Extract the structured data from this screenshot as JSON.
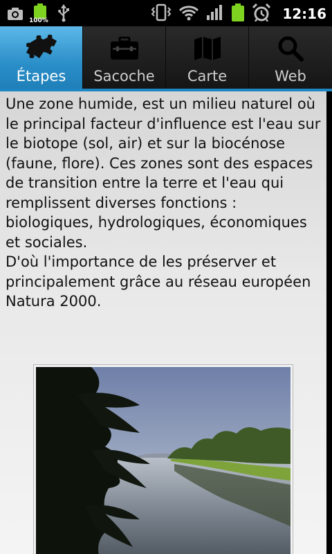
{
  "status_bar": {
    "battery_percent_label": "100%",
    "time": "12:16",
    "icons": [
      "camera-icon",
      "battery-icon",
      "usb-icon",
      "vibrate-icon",
      "wifi-icon",
      "signal-icon",
      "battery-charging-icon",
      "alarm-icon"
    ]
  },
  "tabs": [
    {
      "label": "Étapes",
      "icon": "puzzle-icon",
      "active": true
    },
    {
      "label": "Sacoche",
      "icon": "briefcase-icon",
      "active": false
    },
    {
      "label": "Carte",
      "icon": "map-icon",
      "active": false
    },
    {
      "label": "Web",
      "icon": "magnifier-icon",
      "active": false
    }
  ],
  "article": {
    "paragraph1": "Une zone humide, est un milieu naturel où le principal facteur d'influence est l'eau sur le biotope (sol, air) et sur la biocénose (faune, flore). Ces zones sont des espaces de transition entre la terre et l'eau qui remplissent diverses fonctions : biologiques, hydrologiques, économiques et sociales.",
    "paragraph2": "D'où l'importance de les préserver et principalement grâce au réseau européen Natura 2000."
  },
  "colors": {
    "tab_active": "#2a8ec8",
    "tab_bar": "#1c1c1c",
    "battery_green": "#7ed321",
    "content_bg": "#e8e8e8"
  }
}
